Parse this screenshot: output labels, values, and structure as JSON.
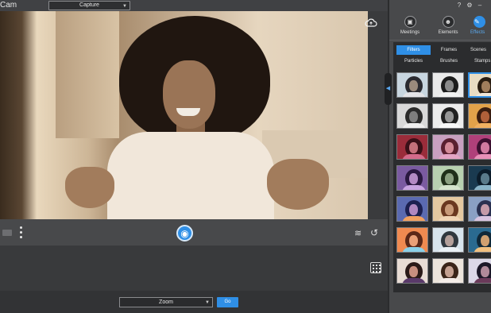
{
  "app": {
    "title": "Cam"
  },
  "header": {
    "mode_select": "Capture"
  },
  "bottom": {
    "zoom_select": "Zoom",
    "go_label": "Go"
  },
  "right_panel": {
    "categories": [
      {
        "label": "Meetings",
        "icon": "meetings-icon"
      },
      {
        "label": "Elements",
        "icon": "elements-icon"
      },
      {
        "label": "Effects",
        "icon": "effects-icon",
        "active": true
      }
    ],
    "tabs_row1": [
      {
        "label": "Filters",
        "active": true
      },
      {
        "label": "Frames"
      },
      {
        "label": "Scenes"
      }
    ],
    "tabs_row2": [
      {
        "label": "Particles"
      },
      {
        "label": "Brushes"
      },
      {
        "label": "Stamps"
      }
    ]
  },
  "icons": {
    "top_right": [
      "help-icon",
      "gear-icon",
      "minimize-icon"
    ],
    "controls": [
      "camera-icon",
      "more-vertical-icon",
      "shutter-icon",
      "layers-icon",
      "undo-icon",
      "grid-icon",
      "cloud-upload-icon"
    ]
  },
  "colors": {
    "accent": "#2f8fe6",
    "panel": "#48494b",
    "dark": "#2b2c2e",
    "preview_tint": "#d9c3a2"
  },
  "filter_thumbnails": [
    {
      "bg": "#c8d6e0",
      "hair": "#2a2a30",
      "face": "#9a8a7c",
      "body": "#e4e4e8"
    },
    {
      "bg": "#eaeaea",
      "hair": "#1c1c1c",
      "face": "#8a8a8a",
      "body": "#f2f2f2"
    },
    {
      "bg": "#e9dcc3",
      "hair": "#2a1d12",
      "face": "#a07d5c",
      "body": "#f0e6d8",
      "selected": true
    },
    {
      "bg": "#d9d9d9",
      "hair": "#2b2b2b",
      "face": "#7e7e7e",
      "body": "#eeeeee"
    },
    {
      "bg": "#ececec",
      "hair": "#202020",
      "face": "#959595",
      "body": "#f7f7f7"
    },
    {
      "bg": "#e2a24a",
      "hair": "#3a1d10",
      "face": "#b0603a",
      "body": "#f0b060"
    },
    {
      "bg": "#9a2c3a",
      "hair": "#3a1018",
      "face": "#c4707a",
      "body": "#d46a8a"
    },
    {
      "bg": "#c8a0c0",
      "hair": "#5a2030",
      "face": "#d48a98",
      "body": "#e4a4c4"
    },
    {
      "bg": "#b0407a",
      "hair": "#3c1030",
      "face": "#d07aa0",
      "body": "#e890b8"
    },
    {
      "bg": "#7a5aa0",
      "hair": "#2a1840",
      "face": "#b48ac4",
      "body": "#c8a4e0"
    },
    {
      "bg": "#b8d0b0",
      "hair": "#20301a",
      "face": "#8aa080",
      "body": "#d4e4cc"
    },
    {
      "bg": "#1a3a50",
      "hair": "#0c1c2a",
      "face": "#5a7a8a",
      "body": "#8ab4c8"
    },
    {
      "bg": "#5a6ab0",
      "hair": "#1c2050",
      "face": "#b088c0",
      "body": "#f0a060"
    },
    {
      "bg": "#e4c8a0",
      "hair": "#6a3820",
      "face": "#c89a78",
      "body": "#f0d4b4"
    },
    {
      "bg": "#8aa0c4",
      "hair": "#2a3050",
      "face": "#c49aa8",
      "body": "#d8c4e0"
    },
    {
      "bg": "#f08a50",
      "hair": "#5a2818",
      "face": "#e8a078",
      "body": "#8ad0e8"
    },
    {
      "bg": "#d8e4ec",
      "hair": "#30383e",
      "face": "#b4a09a",
      "body": "#eaf0f4"
    },
    {
      "bg": "#2a6a90",
      "hair": "#102838",
      "face": "#d0a070",
      "body": "#f0c080"
    },
    {
      "bg": "#e8dcd4",
      "hair": "#2a1a18",
      "face": "#c89080",
      "body": "#5a3a6a"
    },
    {
      "bg": "#ece4dc",
      "hair": "#3a2418",
      "face": "#c4a090",
      "body": "#f4ece8"
    },
    {
      "bg": "#dcd8e8",
      "hair": "#1c1828",
      "face": "#b08a9a",
      "body": "#6a3a5a"
    }
  ]
}
